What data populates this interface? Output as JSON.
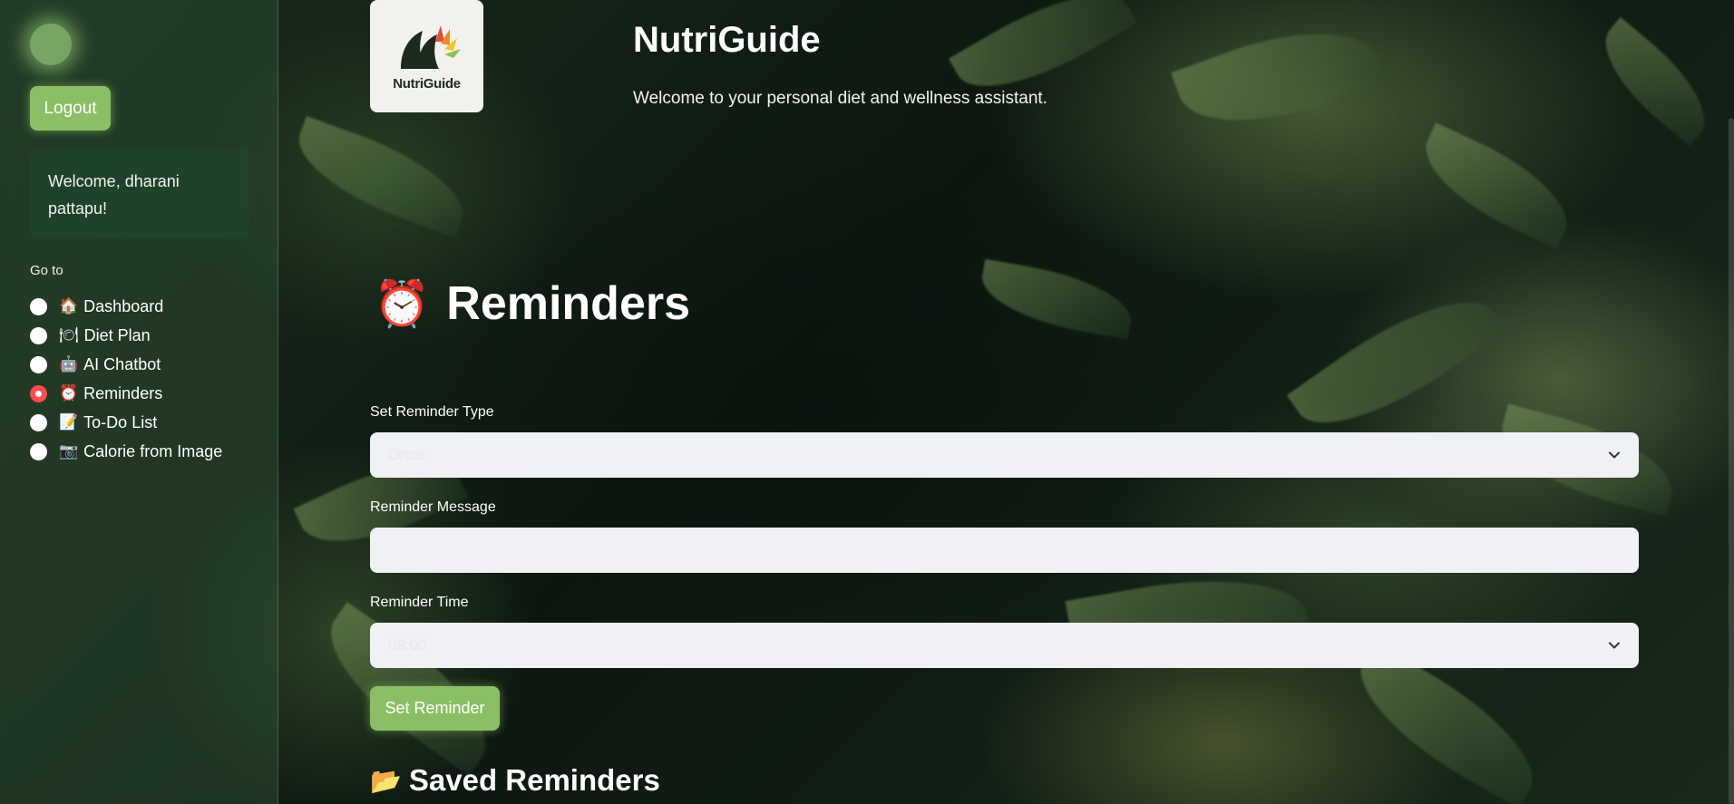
{
  "app": {
    "title": "NutriGuide",
    "subtitle": "Welcome to your personal diet and wellness assistant.",
    "logo_text": "NutriGuide"
  },
  "sidebar": {
    "logout_label": "Logout",
    "welcome_text": "Welcome, dharani pattapu!",
    "nav_title": "Go to",
    "items": [
      {
        "icon": "🏠",
        "label": "Dashboard",
        "selected": false
      },
      {
        "icon": "🍽",
        "label": "Diet Plan",
        "selected": false
      },
      {
        "icon": "🤖",
        "label": "AI Chatbot",
        "selected": false
      },
      {
        "icon": "⏰",
        "label": "Reminders",
        "selected": true
      },
      {
        "icon": "📝",
        "label": "To-Do List",
        "selected": false
      },
      {
        "icon": "📷",
        "label": "Calorie from Image",
        "selected": false
      }
    ]
  },
  "main": {
    "heading_icon": "⏰",
    "heading": "Reminders",
    "type_label": "Set Reminder Type",
    "type_value": "Once",
    "message_label": "Reminder Message",
    "message_value": "",
    "time_label": "Reminder Time",
    "time_value": "08:00",
    "set_button": "Set Reminder",
    "saved_icon": "📂",
    "saved_heading": "Saved Reminders"
  },
  "colors": {
    "accent_button": "#8bbf66",
    "radio_selected": "#ff4b4b",
    "input_bg": "#f0f1f4"
  }
}
